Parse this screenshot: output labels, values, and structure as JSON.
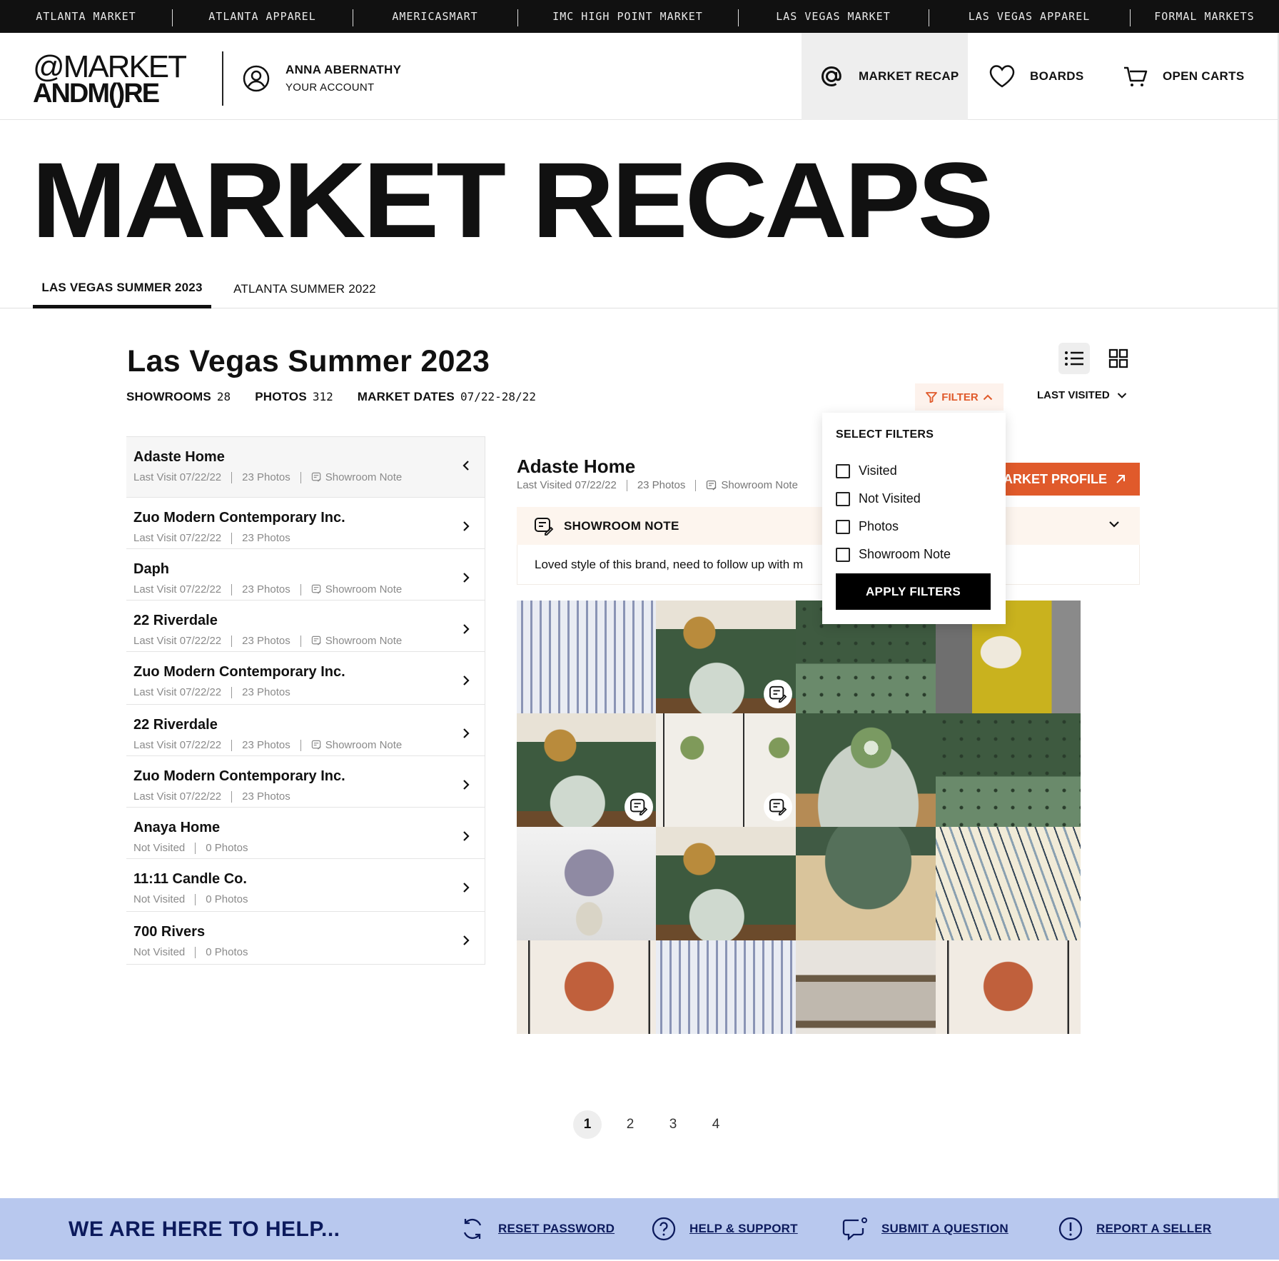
{
  "topbar": {
    "markets": [
      "ATLANTA MARKET",
      "ATLANTA APPAREL",
      "AMERICASMART",
      "IMC HIGH POINT MARKET",
      "LAS VEGAS MARKET",
      "LAS VEGAS APPAREL",
      "FORMAL MARKETS"
    ]
  },
  "header": {
    "logo_line1": "@MARKET",
    "logo_line2": "ANDM()RE",
    "account_name": "ANNA ABERNATHY",
    "account_sub": "YOUR ACCOUNT",
    "nav": {
      "market_recap": "MARKET RECAP",
      "boards": "BOARDS",
      "open_carts": "OPEN CARTS"
    }
  },
  "page_title": "MARKET RECAPS",
  "tabs": [
    "LAS VEGAS SUMMER 2023",
    "ATLANTA SUMMER 2022"
  ],
  "section": {
    "title": "Las Vegas Summer 2023",
    "stats": {
      "showrooms_label": "SHOWROOMS",
      "showrooms_value": "28",
      "photos_label": "PHOTOS",
      "photos_value": "312",
      "dates_label": "MARKET DATES",
      "dates_value": "07/22-28/22"
    },
    "filter_label": "FILTER",
    "sort_label": "LAST VISITED"
  },
  "showrooms": [
    {
      "name": "Adaste Home",
      "visit": "Last Visit 07/22/22",
      "photos": "23 Photos",
      "note": "Showroom Note"
    },
    {
      "name": "Zuo Modern Contemporary Inc.",
      "visit": "Last Visit 07/22/22",
      "photos": "23 Photos",
      "note": ""
    },
    {
      "name": "Daph",
      "visit": "Last Visit 07/22/22",
      "photos": "23 Photos",
      "note": "Showroom Note"
    },
    {
      "name": "22 Riverdale",
      "visit": "Last Visit 07/22/22",
      "photos": "23 Photos",
      "note": "Showroom Note"
    },
    {
      "name": "Zuo Modern Contemporary Inc.",
      "visit": "Last Visit 07/22/22",
      "photos": "23 Photos",
      "note": ""
    },
    {
      "name": "22 Riverdale",
      "visit": "Last Visit 07/22/22",
      "photos": "23 Photos",
      "note": "Showroom Note"
    },
    {
      "name": "Zuo Modern Contemporary Inc.",
      "visit": "Last Visit 07/22/22",
      "photos": "23 Photos",
      "note": ""
    },
    {
      "name": "Anaya Home",
      "visit": "Not Visited",
      "photos": "0 Photos",
      "note": ""
    },
    {
      "name": "11:11 Candle Co.",
      "visit": "Not Visited",
      "photos": "0 Photos",
      "note": ""
    },
    {
      "name": "700 Rivers",
      "visit": "Not Visited",
      "photos": "0 Photos",
      "note": ""
    }
  ],
  "detail": {
    "name": "Adaste Home",
    "visited": "Last Visited 07/22/22",
    "photos": "23 Photos",
    "note_label": "Showroom Note",
    "market_profile": "MARKET PROFILE",
    "note_header": "SHOWROOM NOTE",
    "note_text": "Loved style of this brand, need to follow up with m"
  },
  "photos": [
    {
      "subject": "striped rug",
      "note": false
    },
    {
      "subject": "green sofa with pillow",
      "note": true
    },
    {
      "subject": "green tufted sofa",
      "note": false
    },
    {
      "subject": "yellow armchair",
      "note": false
    },
    {
      "subject": "green sofa with pillow",
      "note": true
    },
    {
      "subject": "framed tree prints",
      "note": true
    },
    {
      "subject": "sofa with flowers",
      "note": false
    },
    {
      "subject": "green tufted sofa",
      "note": false
    },
    {
      "subject": "lavender in vase",
      "note": false
    },
    {
      "subject": "green sofa with pillow",
      "note": false
    },
    {
      "subject": "glass coffee table",
      "note": false
    },
    {
      "subject": "striped pillow",
      "note": false
    },
    {
      "subject": "red tree print",
      "note": false
    },
    {
      "subject": "striped rug",
      "note": false
    },
    {
      "subject": "shelf console",
      "note": false
    },
    {
      "subject": "red tree print",
      "note": false
    }
  ],
  "filters": {
    "heading": "SELECT FILTERS",
    "options": [
      "Visited",
      "Not Visited",
      "Photos",
      "Showroom Note"
    ],
    "apply": "APPLY FILTERS"
  },
  "pagination": {
    "pages": [
      "1",
      "2",
      "3",
      "4"
    ],
    "current": "1"
  },
  "help": {
    "title": "WE ARE HERE TO HELP...",
    "links": [
      "RESET PASSWORD",
      "HELP & SUPPORT",
      "SUBMIT A QUESTION",
      "REPORT A SELLER"
    ]
  },
  "colors": {
    "accent": "#e05a2b",
    "help_bg": "#b8c8ee",
    "help_text": "#0c1a5c"
  }
}
